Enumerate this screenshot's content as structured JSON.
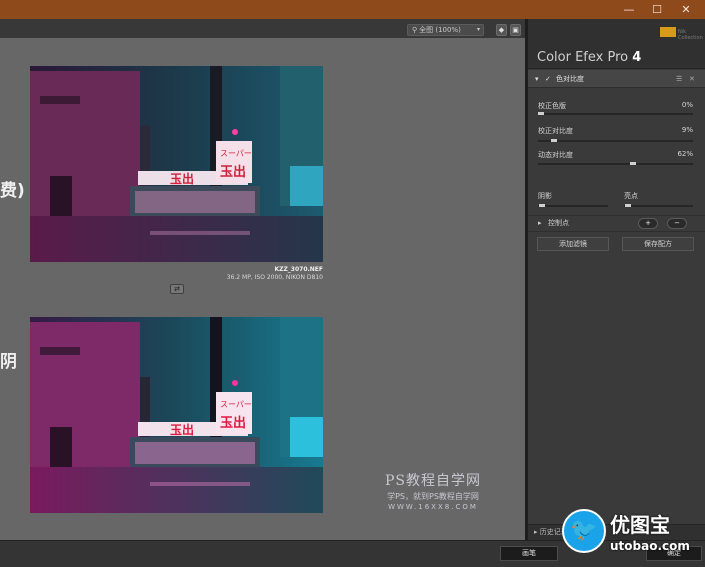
{
  "window": {
    "minimize_glyph": "—",
    "maximize_glyph": "☐",
    "close_glyph": "✕"
  },
  "toolbar": {
    "zoom_label": "全图 (100%)",
    "search_icon": "⚲",
    "chevron": "▾",
    "icon1": "◆",
    "icon2": "▣"
  },
  "canvas": {
    "side_text_top": "费)",
    "side_text_bottom": "阴",
    "top_photo": {
      "filename": "KZZ_3070.NEF",
      "info": "36.2 MP, ISO 2000, NIKON D810",
      "sign1": "スーパー",
      "sign2": "玉出",
      "sign3": "玉出"
    },
    "bottom_photo": {
      "sign1": "スーパー",
      "sign2": "玉出",
      "sign3": "玉出"
    },
    "compare_icon": "⇄",
    "watermark": {
      "line1": "PS教程自学网",
      "line2": "学PS，就到PS教程自学网",
      "line3": "WWW.16XX8.COM"
    }
  },
  "panel": {
    "brand_badge": "Nik Collection",
    "title_text": "Color Efex Pro",
    "title_num": "4",
    "filter": {
      "expand": "▾",
      "check": "✓",
      "name": "色对比度",
      "menu_icon": "☰",
      "close_icon": "✕"
    },
    "sliders": [
      {
        "label": "校正色版",
        "value": "0%",
        "level": 0.0
      },
      {
        "label": "校正对比度",
        "value": "9%",
        "level": 0.09
      },
      {
        "label": "动态对比度",
        "value": "62%",
        "level": 0.62
      }
    ],
    "shadow_label": "阴影",
    "highlight_label": "亮点",
    "control_points_label": "控制点",
    "cp_add": "+",
    "cp_sub": "−",
    "add_filter": "添加滤镜",
    "save_recipe": "保存配方",
    "footer_label": "历史记录与方"
  },
  "bottom": {
    "btn1": "画笔",
    "btn2": "确定"
  },
  "logo": {
    "cn": "优图宝",
    "url": "utobao.com",
    "bird": "🐦"
  },
  "colors": {
    "titlebar": "#8f4a1c",
    "canvas": "#676767",
    "panel": "#3a3a3a",
    "logo_blue": "#1aa3e8"
  }
}
